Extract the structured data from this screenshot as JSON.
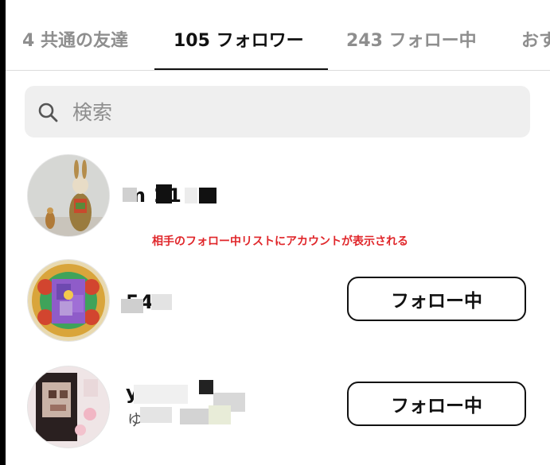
{
  "tabs": [
    {
      "label": "4 共通の友達",
      "active": false
    },
    {
      "label": "105 フォロワー",
      "active": true
    },
    {
      "label": "243 フォロー中",
      "active": false
    },
    {
      "label": "おす",
      "active": false
    }
  ],
  "search": {
    "placeholder": "検索",
    "value": "",
    "icon": "search-icon"
  },
  "annotation": "相手のフォロー中リストにアカウントが表示される",
  "users": [
    {
      "username": "m    21",
      "subtitle": "",
      "button": ""
    },
    {
      "username": "    548",
      "subtitle": "",
      "button": "フォロー中"
    },
    {
      "username": "y         s",
      "subtitle": "ゆ",
      "button": "フォロー中"
    }
  ],
  "colors": {
    "annotation": "#e0262a",
    "active_tab": "#111111",
    "inactive_tab": "#8e8e8e",
    "search_bg": "#efefef"
  }
}
